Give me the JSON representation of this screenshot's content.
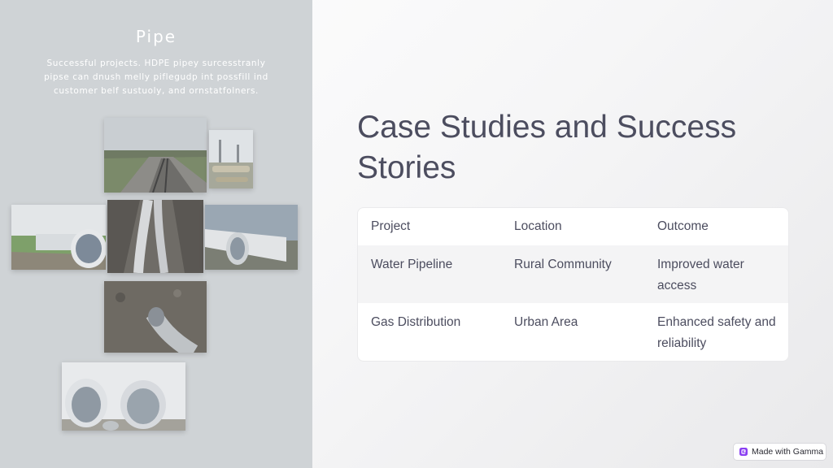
{
  "collage": {
    "title": "Pipe",
    "caption": "Successful projects. HDPE pipey surcesstranly pipse can dnush melly piflegudp int possfill ind customer belf sustuoly, and ornstatfolners."
  },
  "slide": {
    "title": "Case Studies and Success Stories"
  },
  "table": {
    "headers": [
      "Project",
      "Location",
      "Outcome"
    ],
    "rows": [
      [
        "Water Pipeline",
        "Rural Community",
        "Improved water access"
      ],
      [
        "Gas Distribution",
        "Urban Area",
        "Enhanced safety and reliability"
      ]
    ]
  },
  "badge": {
    "label": "Made with Gamma",
    "icon": "gamma-logo-icon",
    "color": "#8a3ff2"
  },
  "colors": {
    "title_text": "#4c4d5f",
    "panel_bg": "#cfd3d6",
    "row_stripe": "#f4f4f5"
  }
}
